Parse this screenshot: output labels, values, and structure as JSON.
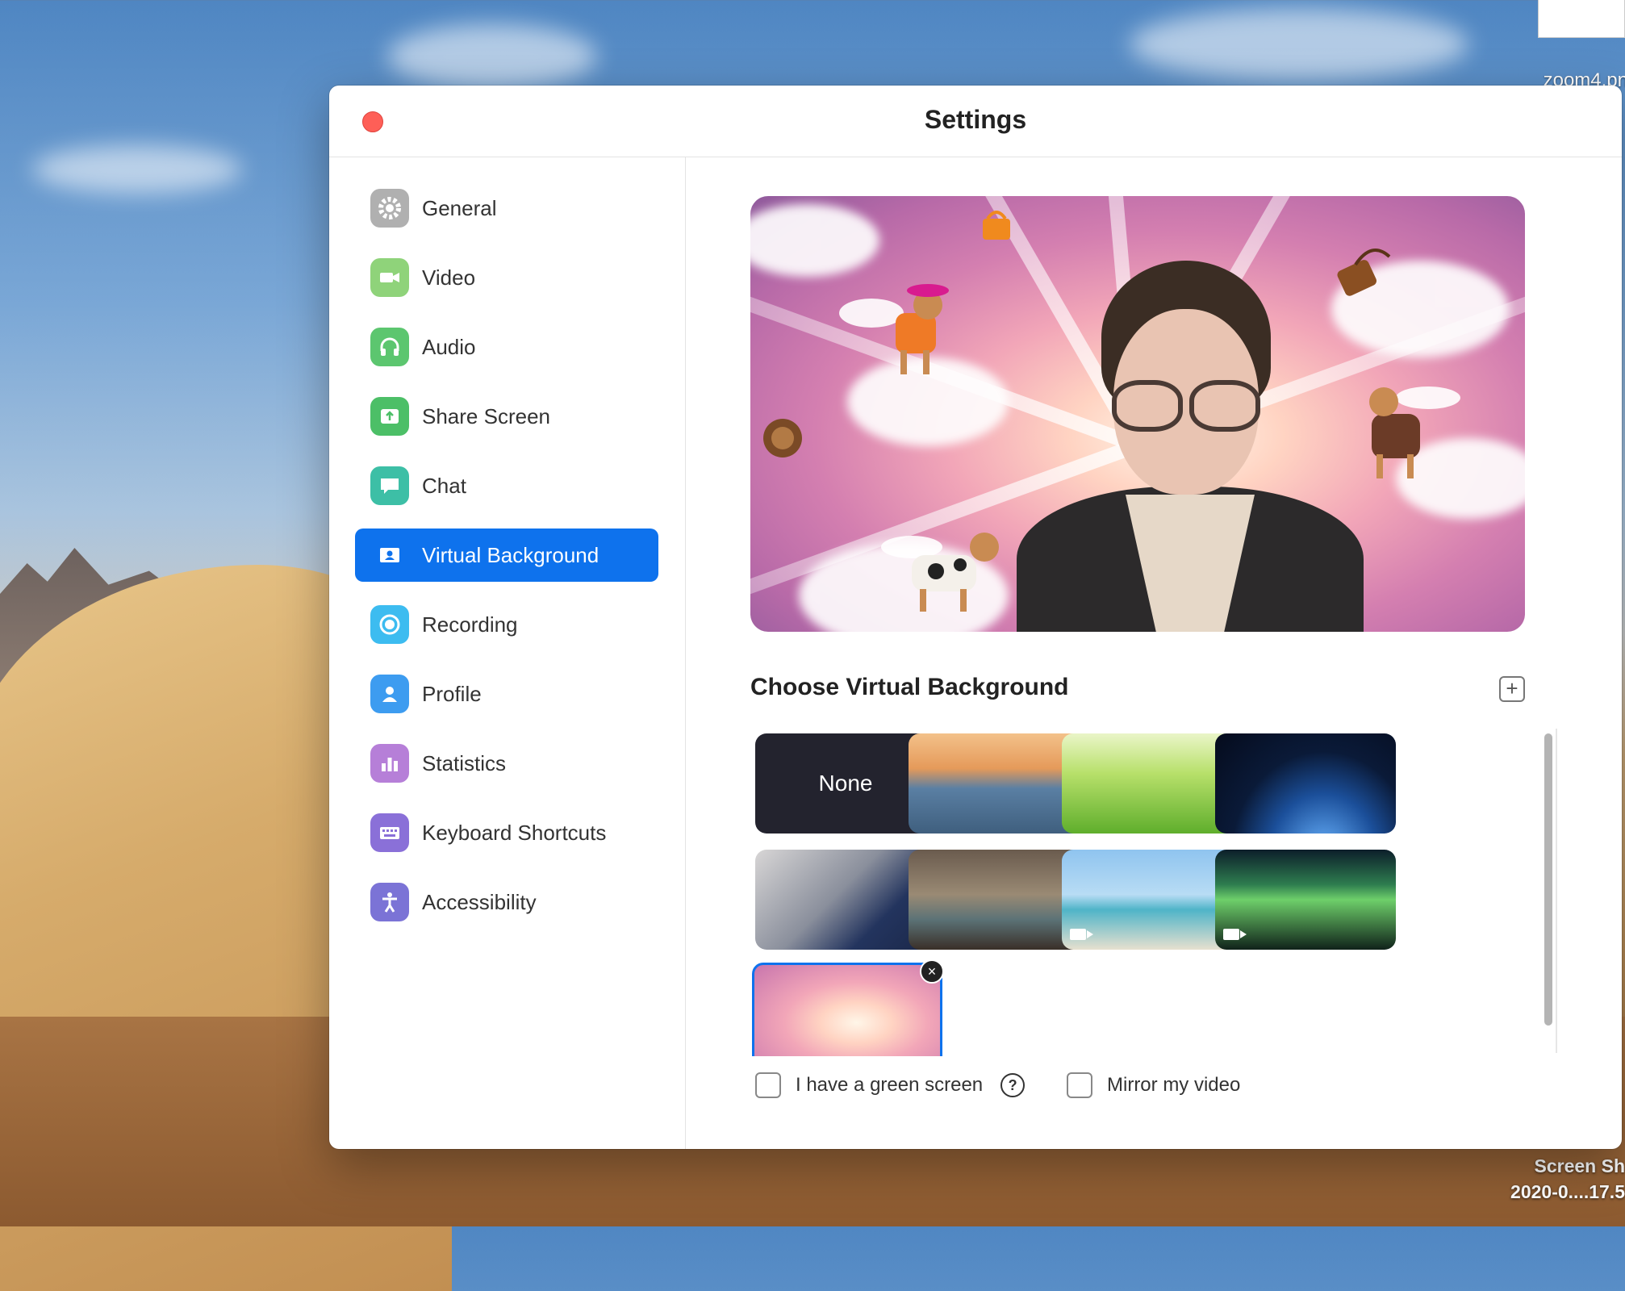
{
  "desktop": {
    "file_label": "zoom4.pn",
    "screenshot_label_line1": "Screen Sh",
    "screenshot_label_line2": "2020-0....17.5"
  },
  "window": {
    "title": "Settings"
  },
  "sidebar": {
    "items": [
      {
        "label": "General",
        "icon": "gear-icon",
        "color": "#b0b0b0"
      },
      {
        "label": "Video",
        "icon": "video-camera-icon",
        "color": "#8fd37a"
      },
      {
        "label": "Audio",
        "icon": "headphones-icon",
        "color": "#5cc66f"
      },
      {
        "label": "Share Screen",
        "icon": "share-screen-icon",
        "color": "#4cbf67"
      },
      {
        "label": "Chat",
        "icon": "chat-bubble-icon",
        "color": "#3dbfa6"
      },
      {
        "label": "Virtual Background",
        "icon": "virtual-background-icon",
        "color": "#0e72ed",
        "active": true
      },
      {
        "label": "Recording",
        "icon": "record-icon",
        "color": "#3dbcf0"
      },
      {
        "label": "Profile",
        "icon": "person-icon",
        "color": "#3d9cf0"
      },
      {
        "label": "Statistics",
        "icon": "bar-chart-icon",
        "color": "#b67fd8"
      },
      {
        "label": "Keyboard Shortcuts",
        "icon": "keyboard-icon",
        "color": "#8a70d8"
      },
      {
        "label": "Accessibility",
        "icon": "accessibility-icon",
        "color": "#7b73d6"
      }
    ]
  },
  "main": {
    "choose_title": "Choose Virtual Background",
    "add_button": "+",
    "backgrounds": [
      {
        "label": "None",
        "kind": "none"
      },
      {
        "label": "",
        "kind": "golden-gate"
      },
      {
        "label": "",
        "kind": "grass"
      },
      {
        "label": "",
        "kind": "earth-space"
      },
      {
        "label": "",
        "kind": "airplane-cabin"
      },
      {
        "label": "",
        "kind": "living-room"
      },
      {
        "label": "",
        "kind": "beach-palm",
        "video": true
      },
      {
        "label": "",
        "kind": "aurora",
        "video": true
      },
      {
        "label": "",
        "kind": "custom-pink-dogs",
        "selected": true
      }
    ],
    "delete_glyph": "×",
    "green_screen_label": "I have a green screen",
    "help_glyph": "?",
    "mirror_label": "Mirror my video"
  },
  "colors": {
    "accent": "#0e72ed",
    "close_button": "#fe5f57"
  }
}
